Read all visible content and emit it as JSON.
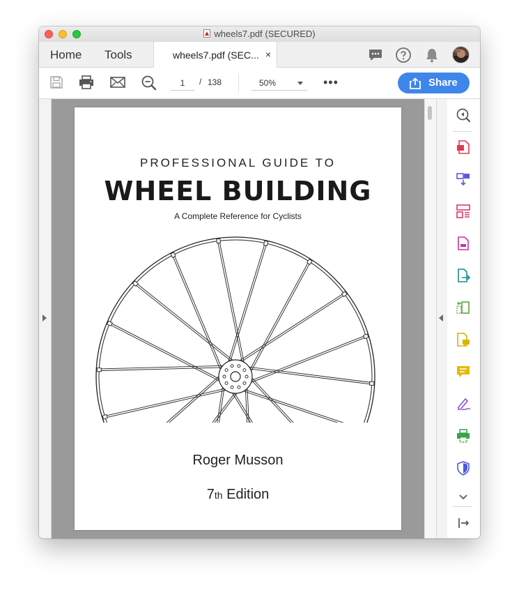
{
  "window": {
    "title": "wheels7.pdf (SECURED)"
  },
  "tabs": {
    "home": "Home",
    "tools": "Tools",
    "doc": "wheels7.pdf (SEC...",
    "close": "×"
  },
  "toolbar": {
    "page_current": "1",
    "page_sep": "/",
    "page_total": "138",
    "zoom": "50%",
    "more": "•••",
    "share_label": "Share"
  },
  "document": {
    "supertitle": "PROFESSIONAL GUIDE TO",
    "title": "WHEEL BUILDING",
    "subtitle": "A Complete Reference for Cyclists",
    "author": "Roger Musson",
    "edition_number": "7",
    "edition_suffix": "th",
    "edition_word": " Edition"
  },
  "right_rail": {
    "icons": [
      "collapse-panel-icon",
      "export-pdf-icon",
      "combine-files-icon",
      "organize-pages-icon",
      "compress-pdf-icon",
      "export-icon",
      "scan-icon",
      "comment-file-icon",
      "comment-icon",
      "fill-sign-icon",
      "print-production-icon",
      "protect-icon",
      "chevron-down-icon",
      "expand-panel-icon"
    ]
  },
  "colors": {
    "accent": "#3f86ea",
    "canvas": "#9a9a9a"
  }
}
